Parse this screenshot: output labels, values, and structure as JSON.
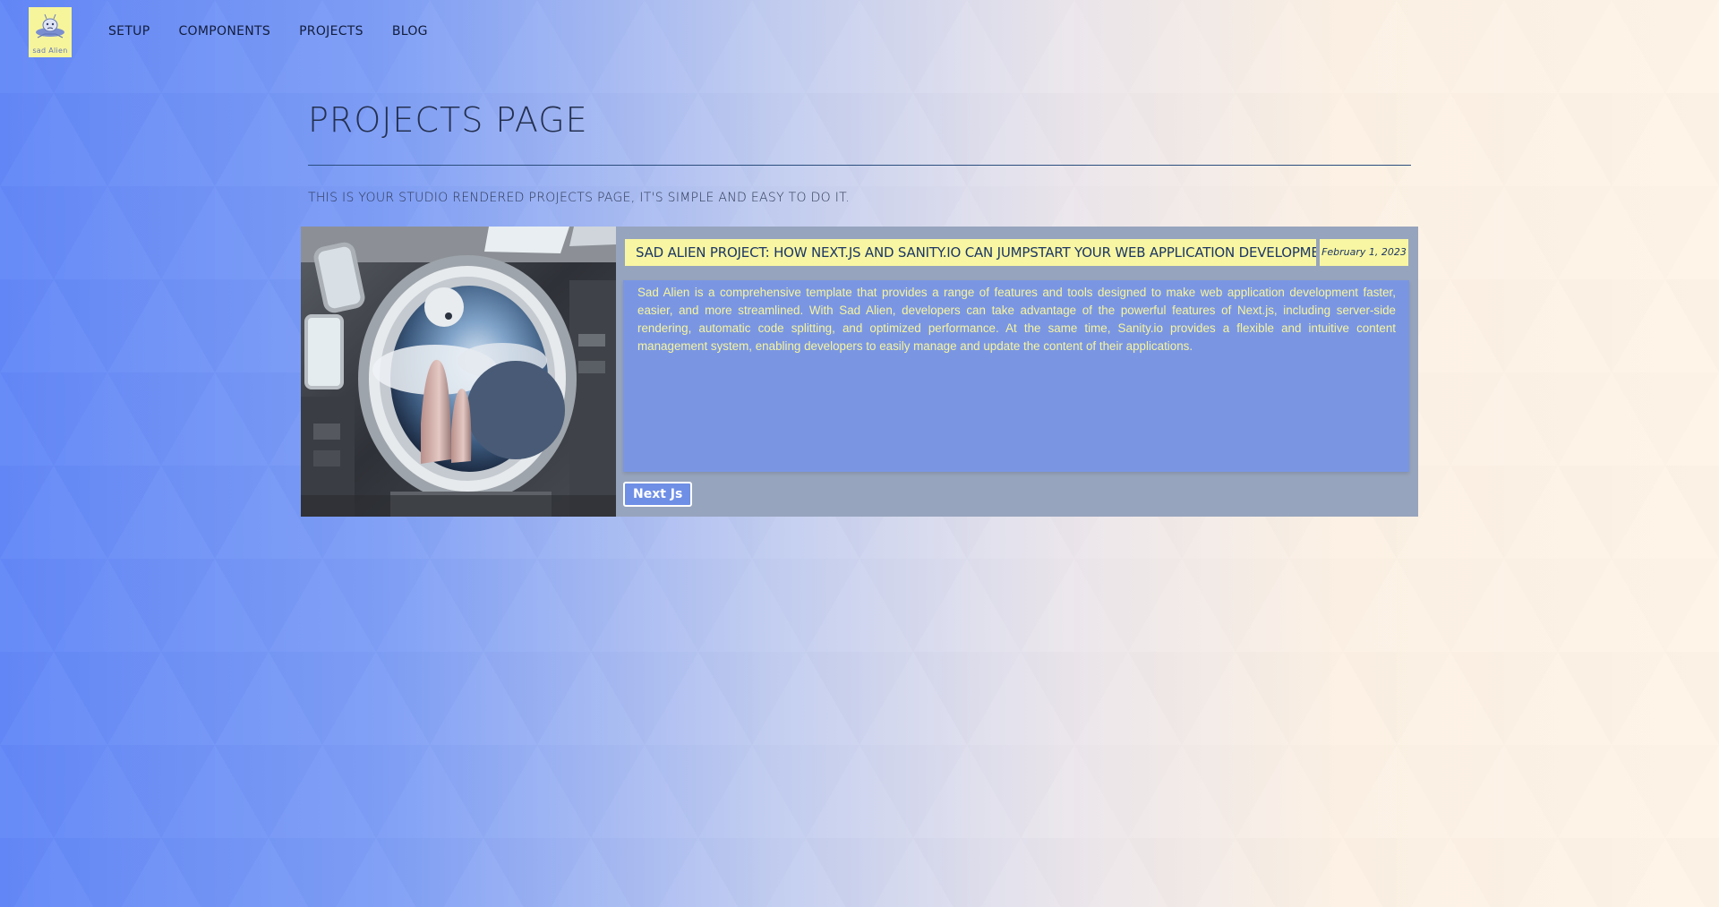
{
  "header": {
    "logo_text": "sad Alien",
    "nav": [
      {
        "label": "SETUP"
      },
      {
        "label": "COMPONENTS"
      },
      {
        "label": "PROJECTS"
      },
      {
        "label": "BLOG"
      }
    ]
  },
  "main": {
    "title": "PROJECTS PAGE",
    "intro": "THIS IS YOUR STUDIO RENDERED PROJECTS PAGE, IT'S SIMPLE AND EASY TO DO IT.",
    "projects": [
      {
        "title": "SAD ALIEN PROJECT: HOW NEXT.JS AND SANITY.IO CAN JUMPSTART YOUR WEB APPLICATION DEVELOPMENT",
        "date": "February 1, 2023",
        "description": "Sad Alien is a comprehensive template that provides a range of features and tools designed to make web application development faster, easier, and more streamlined. With Sad Alien, developers can take advantage of the powerful features of Next.js, including server-side rendering, automatic code splitting, and optimized performance. At the same time, Sanity.io provides a flexible and intuitive content management system, enabling developers to easily manage and update the content of their applications.",
        "tag": "Next Js"
      }
    ]
  },
  "colors": {
    "accent_yellow": "#f8f6a2",
    "card_bg": "#97a4bd",
    "desc_bg": "#7a96e3",
    "gradient_left": "#6388f7",
    "gradient_right": "#fef4e8"
  }
}
